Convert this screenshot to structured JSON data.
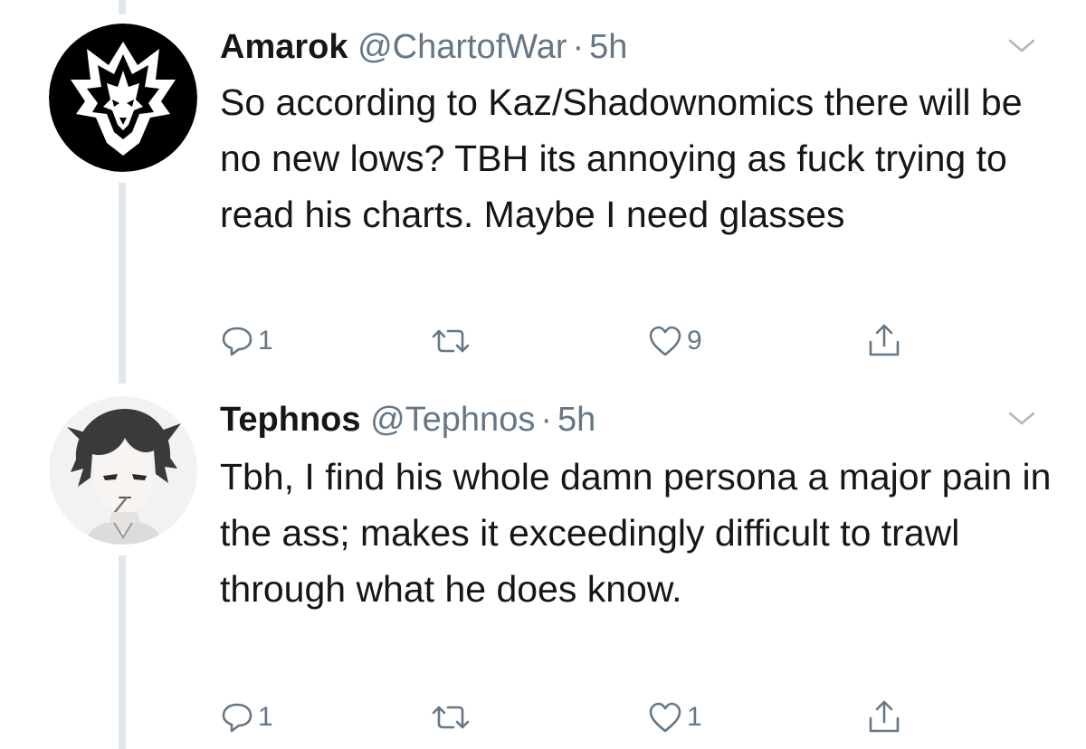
{
  "tweets": [
    {
      "name": "Amarok",
      "handle": "@ChartofWar",
      "separator": "·",
      "time": "5h",
      "text": "So according to Kaz/Shadownomics there will be no new lows?  TBH its annoying as fuck trying to read his charts.  Maybe I need glasses",
      "replies": "1",
      "retweets": "",
      "likes": "9"
    },
    {
      "name": "Tephnos",
      "handle": "@Tephnos",
      "separator": "·",
      "time": "5h",
      "text": "Tbh, I find his whole damn persona a major pain in the ass; makes it exceedingly difficult to trawl through what he does know.",
      "replies": "1",
      "retweets": "",
      "likes": "1"
    }
  ],
  "colors": {
    "text": "#14171a",
    "secondary": "#657786",
    "thread_line": "#e1e8ed"
  },
  "icons": [
    "wolf-avatar",
    "anime-avatar",
    "chevron-down-icon",
    "reply-icon",
    "retweet-icon",
    "like-icon",
    "share-icon"
  ]
}
